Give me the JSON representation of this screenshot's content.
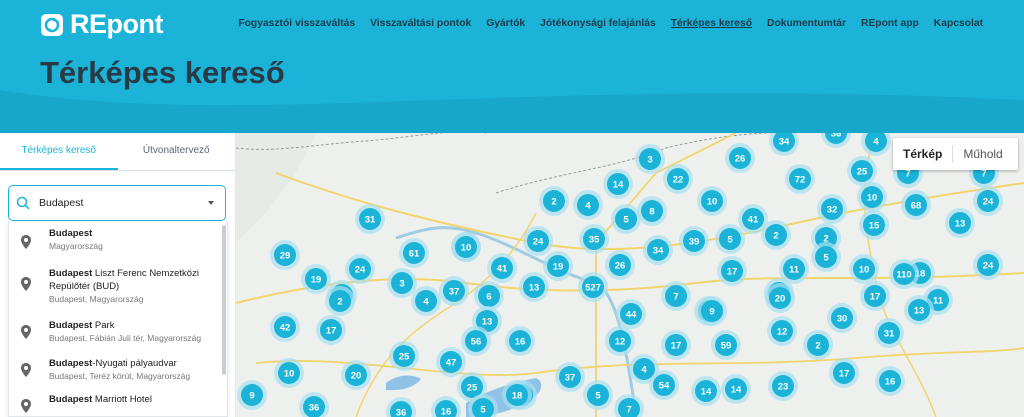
{
  "brand": {
    "name": "REpont",
    "color": "#1bb4d8"
  },
  "nav": [
    "Fogyasztói visszaváltás",
    "Visszaváltási pontok",
    "Gyártók",
    "Jótékonysági felajánlás",
    "Térképes kereső",
    "Dokumentumtár",
    "REpont app",
    "Kapcsolat"
  ],
  "page": {
    "title": "Térképes kereső"
  },
  "sidebar": {
    "tabs": [
      "Térképes kereső",
      "Útvonaltervező"
    ],
    "search": {
      "value": "Budapest"
    },
    "results": [
      {
        "bold": "Budapest",
        "rest": "",
        "sub": "Magyarország"
      },
      {
        "bold": "Budapest",
        "rest": " Liszt Ferenc Nemzetközi Repülőtér (BUD)",
        "sub": "Budapest, Magyarország"
      },
      {
        "bold": "Budapest",
        "rest": " Park",
        "sub": "Budapest, Fábián Juli tér, Magyarország"
      },
      {
        "bold": "Budapest",
        "rest": "-Nyugati pályaudvar",
        "sub": "Budapest, Teréz körút, Magyarország"
      },
      {
        "bold": "Budapest",
        "rest": " Marriott Hotel",
        "sub": ""
      }
    ]
  },
  "map": {
    "type_options": [
      "Térkép",
      "Műhold"
    ],
    "cluster_counts": [
      36,
      4,
      34,
      26,
      3,
      25,
      7,
      14,
      22,
      72,
      7,
      10,
      68,
      24,
      2,
      4,
      5,
      8,
      10,
      41,
      32,
      13,
      31,
      2,
      15,
      10,
      24,
      35,
      5,
      2,
      34,
      39,
      5,
      29,
      61,
      10,
      26,
      24,
      17,
      11,
      10,
      19,
      41,
      19,
      13,
      3,
      527,
      18,
      110,
      24,
      7,
      37,
      6,
      7,
      20,
      4,
      2,
      17,
      11,
      13,
      20,
      44,
      9,
      30,
      13,
      42,
      17,
      9,
      12,
      56,
      16,
      12,
      17,
      59,
      2,
      31,
      25,
      47,
      4,
      37,
      17,
      16,
      10,
      20,
      25,
      54,
      5,
      14,
      14,
      18,
      23,
      9,
      36,
      36,
      16,
      5,
      7,
      18
    ]
  },
  "colors": {
    "cluster_fill": "#1bb4d8",
    "cluster_halo": "#a8dff0"
  }
}
